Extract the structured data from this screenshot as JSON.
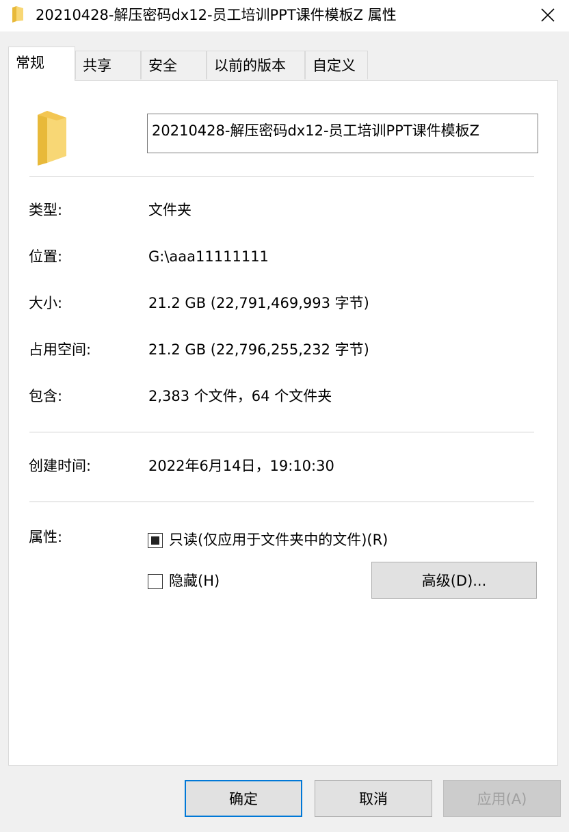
{
  "window": {
    "title": "20210428-解压密码dx12-员工培训PPT课件模板Z 属性",
    "icon": "folder-icon",
    "close_icon": "close-icon"
  },
  "tabs": [
    {
      "label": "常规",
      "active": true
    },
    {
      "label": "共享",
      "active": false
    },
    {
      "label": "安全",
      "active": false
    },
    {
      "label": "以前的版本",
      "active": false
    },
    {
      "label": "自定义",
      "active": false
    }
  ],
  "general": {
    "folder_name": "20210428-解压密码dx12-员工培训PPT课件模板Z",
    "type_label": "类型:",
    "type_value": "文件夹",
    "location_label": "位置:",
    "location_value": "G:\\aaa11111111",
    "size_label": "大小:",
    "size_value": "21.2 GB (22,791,469,993 字节)",
    "size_on_disk_label": "占用空间:",
    "size_on_disk_value": "21.2 GB (22,796,255,232 字节)",
    "contains_label": "包含:",
    "contains_value": "2,383 个文件，64 个文件夹",
    "created_label": "创建时间:",
    "created_value": "2022年6月14日，19:10:30",
    "attributes_label": "属性:",
    "readonly_label": "只读(仅应用于文件夹中的文件)(R)",
    "readonly_state": "indeterminate",
    "hidden_label": "隐藏(H)",
    "hidden_state": "unchecked",
    "advanced_button": "高级(D)..."
  },
  "footer": {
    "ok_label": "确定",
    "cancel_label": "取消",
    "apply_label": "应用(A)"
  },
  "colors": {
    "folder": "#f8d775",
    "default_button_border": "#0078d7",
    "disabled_text": "#a0a0a0"
  }
}
